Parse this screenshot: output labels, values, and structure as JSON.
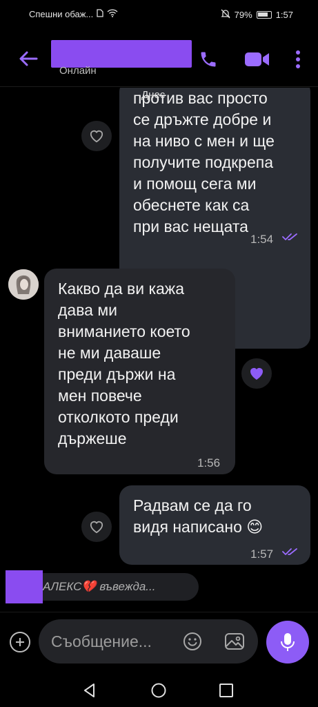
{
  "status_bar": {
    "left_text": "Спешни обаж...",
    "battery": "79%",
    "time": "1:57"
  },
  "header": {
    "presence": "Онлайн"
  },
  "chat": {
    "date_label": "Днес",
    "messages": [
      {
        "direction": "outgoing",
        "lines": [
          "против вас просто",
          "се дръжте добре и",
          "на ниво с мен и ще",
          "получите подкрепа",
          "и помощ сега ми",
          "обеснете как са",
          "при вас нещата"
        ],
        "time": "1:54",
        "status": "read"
      },
      {
        "direction": "incoming",
        "lines": [
          "Какво да ви кажа",
          "дава ми",
          "вниманието което",
          "не ми даваше",
          "преди държи на",
          "мен повече",
          "отколкото преди",
          "държеше"
        ],
        "time": "1:56",
        "liked": true
      },
      {
        "direction": "outgoing",
        "lines": [
          "Радвам се да го",
          "видя написано 😊"
        ],
        "time": "1:57",
        "status": "read"
      }
    ]
  },
  "typing": {
    "text": "АЛЕКС💔 въвежда..."
  },
  "composer": {
    "placeholder": "Съобщение..."
  },
  "colors": {
    "accent": "#8d5cf6",
    "redaction": "#8a4cf0",
    "bubble_out": "#2a2d34",
    "bubble_in": "#26272c"
  },
  "icons": [
    "back-arrow-icon",
    "phone-icon",
    "video-icon",
    "more-icon",
    "heart-icon",
    "plus-icon",
    "emoji-icon",
    "image-icon",
    "mic-icon",
    "nav-back-icon",
    "nav-home-icon",
    "nav-recents-icon"
  ]
}
